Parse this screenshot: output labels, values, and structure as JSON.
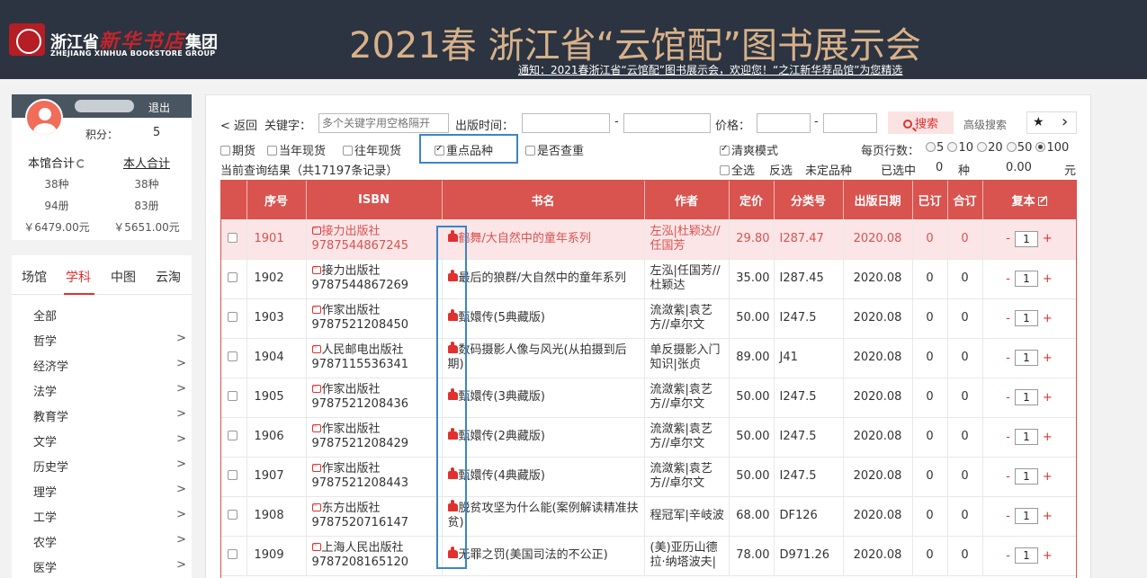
{
  "header": {
    "logo_left": "浙江省",
    "logo_calligraphy": "新华书店",
    "logo_right": "集团",
    "logo_sub": "ZHEJIANG XINHUA BOOKSTORE GROUP",
    "title": "2021春 浙江省“云馆配”图书展示会",
    "notice": "通知：2021春浙江省“云馆配”图书展示会，欢迎您！“之江新华荐品馆”为您精选"
  },
  "user": {
    "logout": "退出",
    "points_label": "积分：",
    "points_value": "5",
    "library_total_label": "本馆合计",
    "personal_total_label": "本人合计",
    "library_kinds": "38种",
    "library_copies": "94册",
    "library_amount": "￥6479.00元",
    "personal_kinds": "38种",
    "personal_copies": "83册",
    "personal_amount": "￥5651.00元"
  },
  "category_tabs": [
    "场馆",
    "学科",
    "中图",
    "云淘"
  ],
  "categories": [
    "全部",
    "哲学",
    "经济学",
    "法学",
    "教育学",
    "文学",
    "历史学",
    "理学",
    "工学",
    "农学",
    "医学"
  ],
  "toolbar": {
    "back": "< 返回",
    "keyword_label": "关键字：",
    "keyword_placeholder": "多个关键字用空格隔开",
    "date_label": "出版时间：",
    "dash": "-",
    "price_label": "价格：",
    "search": "搜索",
    "advanced": "高级搜索",
    "star": "★",
    "next": "›",
    "chk_futures": "期货",
    "chk_current_year": "当年现货",
    "chk_past_year": "往年现货",
    "chk_key": "重点品种",
    "chk_dup": "是否查重",
    "chk_clean": "清爽模式",
    "rows_label": "每页行数：",
    "rows_options": [
      "5",
      "10",
      "20",
      "50",
      "100"
    ],
    "result": "当前查询结果（共17197条记录）",
    "select_all": "全选",
    "invert": "反选",
    "undetermined": "未定品种",
    "selected_label": "已选中",
    "selected_count": "0",
    "kinds_unit": "种",
    "selected_amount": "0.00",
    "yuan_unit": "元"
  },
  "table": {
    "headers": [
      "序号",
      "ISBN",
      "书名",
      "作者",
      "定价",
      "分类号",
      "出版日期",
      "已订",
      "合订",
      "复本"
    ],
    "rows": [
      {
        "seq": "1901",
        "publisher": "接力出版社",
        "isbn": "9787544867245",
        "title": "鹤舞/大自然中的童年系列",
        "author": "左泓|杜颖达//任国芳",
        "price": "29.80",
        "cls": "I287.47",
        "date": "2020.08",
        "ordered": "0",
        "combined": "0",
        "qty": "1"
      },
      {
        "seq": "1902",
        "publisher": "接力出版社",
        "isbn": "9787544867269",
        "title": "最后的狼群/大自然中的童年系列",
        "author": "左泓|任国芳//杜颖达",
        "price": "35.00",
        "cls": "I287.45",
        "date": "2020.08",
        "ordered": "0",
        "combined": "0",
        "qty": "1"
      },
      {
        "seq": "1903",
        "publisher": "作家出版社",
        "isbn": "9787521208450",
        "title": "甄嬛传(5典藏版)",
        "author": "流潋紫|袁艺方//卓尔文",
        "price": "50.00",
        "cls": "I247.5",
        "date": "2020.08",
        "ordered": "0",
        "combined": "0",
        "qty": "1"
      },
      {
        "seq": "1904",
        "publisher": "人民邮电出版社",
        "isbn": "9787115536341",
        "title": "数码摄影人像与风光(从拍摄到后期)",
        "author": "单反摄影入门知识|张贞",
        "price": "89.00",
        "cls": "J41",
        "date": "2020.08",
        "ordered": "0",
        "combined": "0",
        "qty": "1"
      },
      {
        "seq": "1905",
        "publisher": "作家出版社",
        "isbn": "9787521208436",
        "title": "甄嬛传(3典藏版)",
        "author": "流潋紫|袁艺方//卓尔文",
        "price": "50.00",
        "cls": "I247.5",
        "date": "2020.08",
        "ordered": "0",
        "combined": "0",
        "qty": "1"
      },
      {
        "seq": "1906",
        "publisher": "作家出版社",
        "isbn": "9787521208429",
        "title": "甄嬛传(2典藏版)",
        "author": "流潋紫|袁艺方//卓尔文",
        "price": "50.00",
        "cls": "I247.5",
        "date": "2020.08",
        "ordered": "0",
        "combined": "0",
        "qty": "1"
      },
      {
        "seq": "1907",
        "publisher": "作家出版社",
        "isbn": "9787521208443",
        "title": "甄嬛传(4典藏版)",
        "author": "流潋紫|袁艺方//卓尔文",
        "price": "50.00",
        "cls": "I247.5",
        "date": "2020.08",
        "ordered": "0",
        "combined": "0",
        "qty": "1"
      },
      {
        "seq": "1908",
        "publisher": "东方出版社",
        "isbn": "9787520716147",
        "title": "脱贫攻坚为什么能(案例解读精准扶贫)",
        "author": "程冠军|辛岐波",
        "price": "68.00",
        "cls": "DF126",
        "date": "2020.08",
        "ordered": "0",
        "combined": "0",
        "qty": "1"
      },
      {
        "seq": "1909",
        "publisher": "上海人民出版社",
        "isbn": "9787208165120",
        "title": "无罪之罚(美国司法的不公正)",
        "author": "(美)亚历山德拉·纳塔波夫|",
        "price": "78.00",
        "cls": "D971.26",
        "date": "2020.08",
        "ordered": "0",
        "combined": "0",
        "qty": "1"
      }
    ],
    "minus": "-",
    "plus": "+"
  }
}
